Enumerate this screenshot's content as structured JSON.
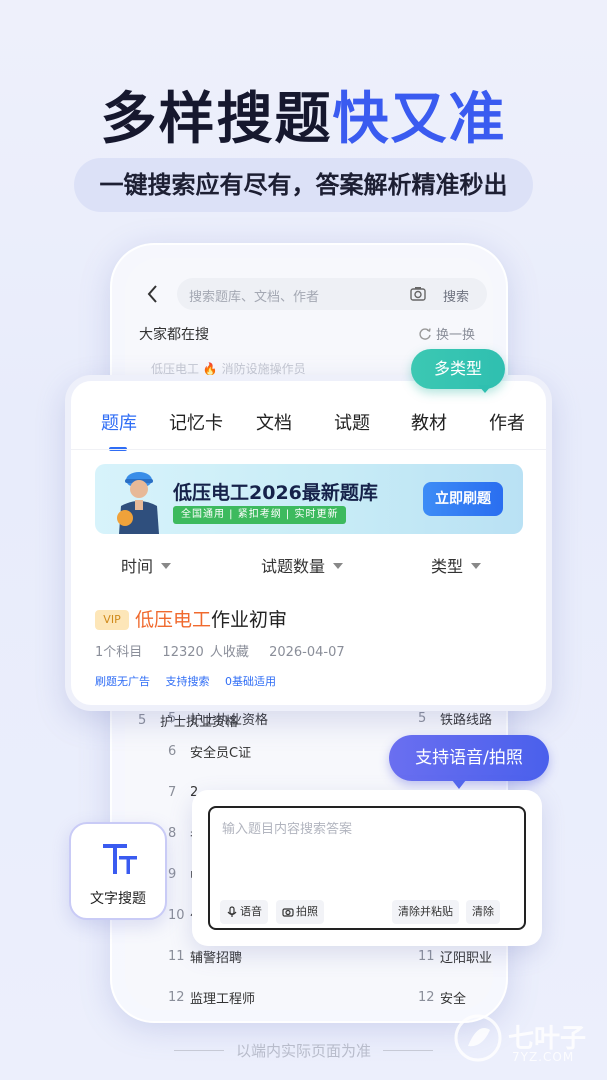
{
  "headline": {
    "part1": "多样搜题",
    "part2": "快又准"
  },
  "subline": "一键搜索应有尽有，答案解析精准秒出",
  "phone": {
    "search_placeholder": "搜索题库、文档、作者",
    "search_button": "搜索",
    "hot_title": "大家都在搜",
    "refresh": "换一换",
    "ghost_row": "低压电工 🔥     消防设施操作员",
    "rank_left": [
      {
        "num": "5",
        "label": "护士执业资格"
      },
      {
        "num": "6",
        "label": "安全员C证"
      },
      {
        "num": "7",
        "label": "2"
      },
      {
        "num": "8",
        "label": "考"
      },
      {
        "num": "9",
        "label": "中"
      },
      {
        "num": "10",
        "label": "化"
      },
      {
        "num": "11",
        "label": "辅警招聘"
      },
      {
        "num": "12",
        "label": "监理工程师"
      }
    ],
    "rank_right": [
      {
        "num": "5",
        "label": "铁路线路"
      },
      {
        "num": "11",
        "label": "辽阳职业"
      },
      {
        "num": "12",
        "label": "安全"
      }
    ]
  },
  "badge_multi": "多类型",
  "card": {
    "tabs": [
      "题库",
      "记忆卡",
      "文档",
      "试题",
      "教材",
      "作者"
    ],
    "banner": {
      "title": "低压电工2026最新题库",
      "tags": "全国通用 | 紧扣考纲 | 实时更新",
      "button": "立即刷题"
    },
    "filters": [
      "时间",
      "试题数量",
      "类型"
    ],
    "result": {
      "vip": "VIP",
      "title_highlight": "低压电工",
      "title_rest": "作业初审",
      "subjects": "1个科目",
      "favorites": "12320 人收藏",
      "date": "2026-04-07",
      "tags": [
        "刷题无广告",
        "支持搜索",
        "0基础适用"
      ]
    }
  },
  "voice_bubble": "支持语音/拍照",
  "input_card": {
    "placeholder": "输入题目内容搜索答案",
    "voice": "语音",
    "photo": "拍照",
    "clear_paste": "清除并粘贴",
    "clear": "清除"
  },
  "text_tile": {
    "label": "文字搜题"
  },
  "footer_note": "以端内实际页面为准",
  "watermark": {
    "name": "七叶子",
    "domain": "7YZ.COM"
  },
  "colors": {
    "accent": "#2f6df5",
    "headline_blue": "#3a5bf0",
    "badge_teal": "#2fbfb0",
    "highlight": "#f06a2e"
  }
}
